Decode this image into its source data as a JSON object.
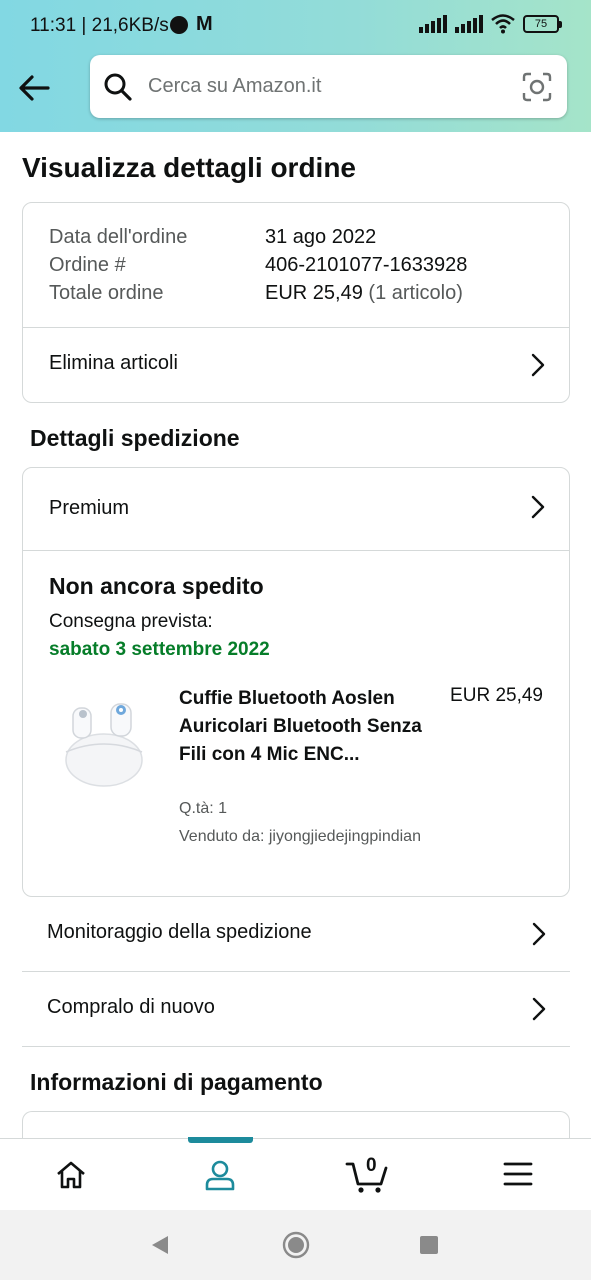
{
  "status_bar": {
    "time": "11:31 | 21,6KB/s",
    "carrier_logo": "M",
    "battery": "75"
  },
  "search": {
    "placeholder": "Cerca su Amazon.it"
  },
  "page_title": "Visualizza dettagli ordine",
  "order_summary": {
    "date_label": "Data dell'ordine",
    "date_value": "31 ago 2022",
    "number_label": "Ordine #",
    "number_value": "406-2101077-1633928",
    "total_label": "Totale ordine",
    "total_value": "EUR 25,49",
    "total_note": "(1 articolo)",
    "delete_items": "Elimina articoli"
  },
  "shipping": {
    "section_title": "Dettagli spedizione",
    "method": "Premium",
    "status": "Non ancora spedito",
    "delivery_label": "Consegna prevista:",
    "delivery_date": "sabato 3 settembre 2022",
    "product": {
      "title": "Cuffie Bluetooth Aoslen Auricolari Bluetooth Senza Fili con 4 Mic ENC...",
      "price": "EUR 25,49",
      "quantity": "Q.tà: 1",
      "seller": "Venduto da: jiyongjiedejingpindian"
    }
  },
  "actions": {
    "track": "Monitoraggio della spedizione",
    "buy_again": "Compralo di nuovo"
  },
  "payment": {
    "section_title": "Informazioni di pagamento"
  },
  "bottom_nav": {
    "cart_count": "0",
    "active": "account"
  },
  "colors": {
    "header_gradient_start": "#82d8e3",
    "header_gradient_end": "#a5e4c9",
    "delivery_green": "#067d29",
    "nav_accent": "#1d8b9c"
  }
}
